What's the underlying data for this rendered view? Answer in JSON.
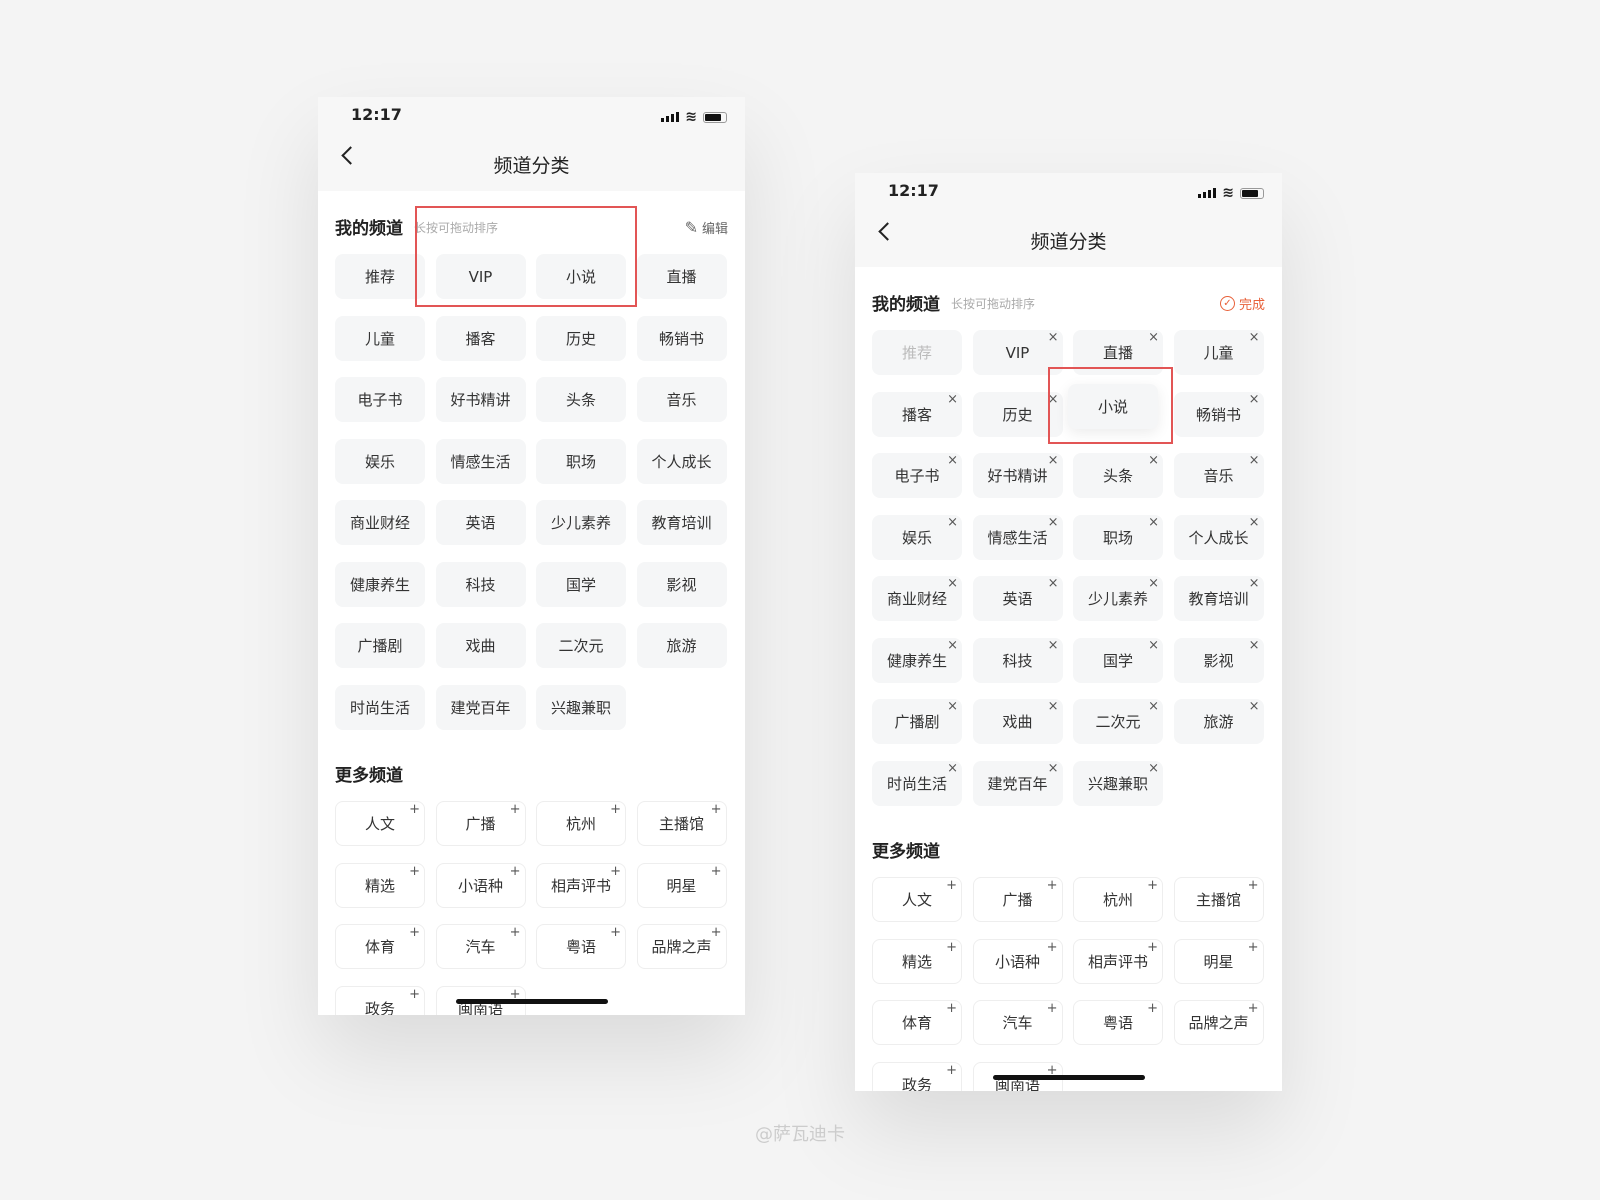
{
  "screens": [
    {
      "time": "12:17",
      "title": "频道分类",
      "my_channels_label": "我的频道",
      "hint": "长按可拖动排序",
      "action_label": "编辑",
      "action_icon": "edit-icon",
      "my_channels": [
        "推荐",
        "VIP",
        "小说",
        "直播",
        "儿童",
        "播客",
        "历史",
        "畅销书",
        "电子书",
        "好书精讲",
        "头条",
        "音乐",
        "娱乐",
        "情感生活",
        "职场",
        "个人成长",
        "商业财经",
        "英语",
        "少儿素养",
        "教育培训",
        "健康养生",
        "科技",
        "国学",
        "影视",
        "广播剧",
        "戏曲",
        "二次元",
        "旅游",
        "时尚生活",
        "建党百年",
        "兴趣兼职"
      ],
      "more_channels_label": "更多频道",
      "more_channels": [
        "人文",
        "广播",
        "杭州",
        "主播馆",
        "精选",
        "小语种",
        "相声评书",
        "明星",
        "体育",
        "汽车",
        "粤语",
        "品牌之声",
        "政务",
        "闽南语"
      ]
    },
    {
      "time": "12:17",
      "title": "频道分类",
      "my_channels_label": "我的频道",
      "hint": "长按可拖动排序",
      "action_label": "完成",
      "action_icon": "check-circle-icon",
      "action_color": "#e8613a",
      "my_channels": [
        "推荐",
        "VIP",
        "直播",
        "儿童",
        "播客",
        "历史",
        "",
        "畅销书",
        "电子书",
        "好书精讲",
        "头条",
        "音乐",
        "娱乐",
        "情感生活",
        "职场",
        "个人成长",
        "商业财经",
        "英语",
        "少儿素养",
        "教育培训",
        "健康养生",
        "科技",
        "国学",
        "影视",
        "广播剧",
        "戏曲",
        "二次元",
        "旅游",
        "时尚生活",
        "建党百年",
        "兴趣兼职"
      ],
      "dragging_channel": "小说",
      "more_channels_label": "更多频道",
      "more_channels": [
        "人文",
        "广播",
        "杭州",
        "主播馆",
        "精选",
        "小语种",
        "相声评书",
        "明星",
        "体育",
        "汽车",
        "粤语",
        "品牌之声",
        "政务",
        "闽南语"
      ]
    }
  ],
  "watermark": "@萨瓦迪卡"
}
